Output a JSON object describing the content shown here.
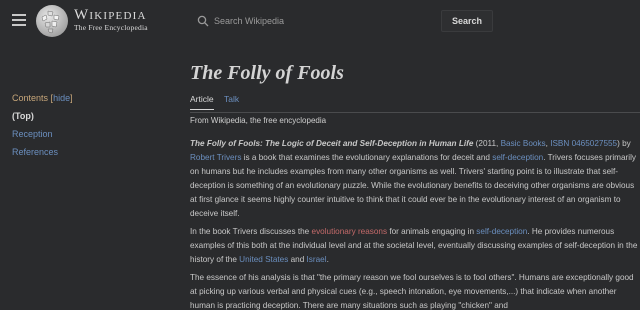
{
  "header": {
    "logo_name": "Wikipedia",
    "logo_tagline": "The Free Encyclopedia",
    "search_placeholder": "Search Wikipedia",
    "search_button": "Search"
  },
  "toc": {
    "title": "Contents",
    "hide_open": "[",
    "hide_label": "hide",
    "hide_close": "]",
    "items": [
      "(Top)",
      "Reception",
      "References"
    ]
  },
  "article": {
    "title": "The Folly of Fools",
    "tabs": [
      "Article",
      "Talk"
    ],
    "from_line": "From Wikipedia, the free encyclopedia",
    "p1": {
      "title_bold": "The Folly of Fools: The Logic of Deceit and Self-Deception in Human Life",
      "t1": " (2011, ",
      "publisher": "Basic Books",
      "t2": ", ",
      "isbn": "ISBN 0465027555",
      "t3": ") by ",
      "author": "Robert Trivers",
      "t4": " is a book that examines the evolutionary explanations for deceit and ",
      "self_dec": "self-deception",
      "t5": ". Trivers focuses primarily on humans but he includes examples from many other organisms as well. Trivers' starting point is to illustrate that self-deception is something of an evolutionary puzzle. While the evolutionary benefits to deceiving other organisms are obvious at first glance it seems highly counter intuitive to think that it could ever be in the evolutionary interest of an organism to deceive itself."
    },
    "p2": {
      "t1": "In the book Trivers discusses the ",
      "evo_reasons": "evolutionary reasons",
      "t2": " for animals engaging in ",
      "self_dec": "self-deception",
      "t3": ". He provides numerous examples of this both at the individual level and at the societal level, eventually discussing examples of self-deception in the history of the ",
      "us": "United States",
      "t4": " and ",
      "israel": "Israel",
      "t5": "."
    },
    "p3": {
      "text": "The essence of his analysis is that \"the primary reason we fool ourselves is to fool others\". Humans are exceptionally good at picking up various verbal and physical cues (e.g., speech intonation, eye movements,...) that indicate when another human is practicing deception. There are many situations such as playing \"chicken\" and"
    }
  }
}
